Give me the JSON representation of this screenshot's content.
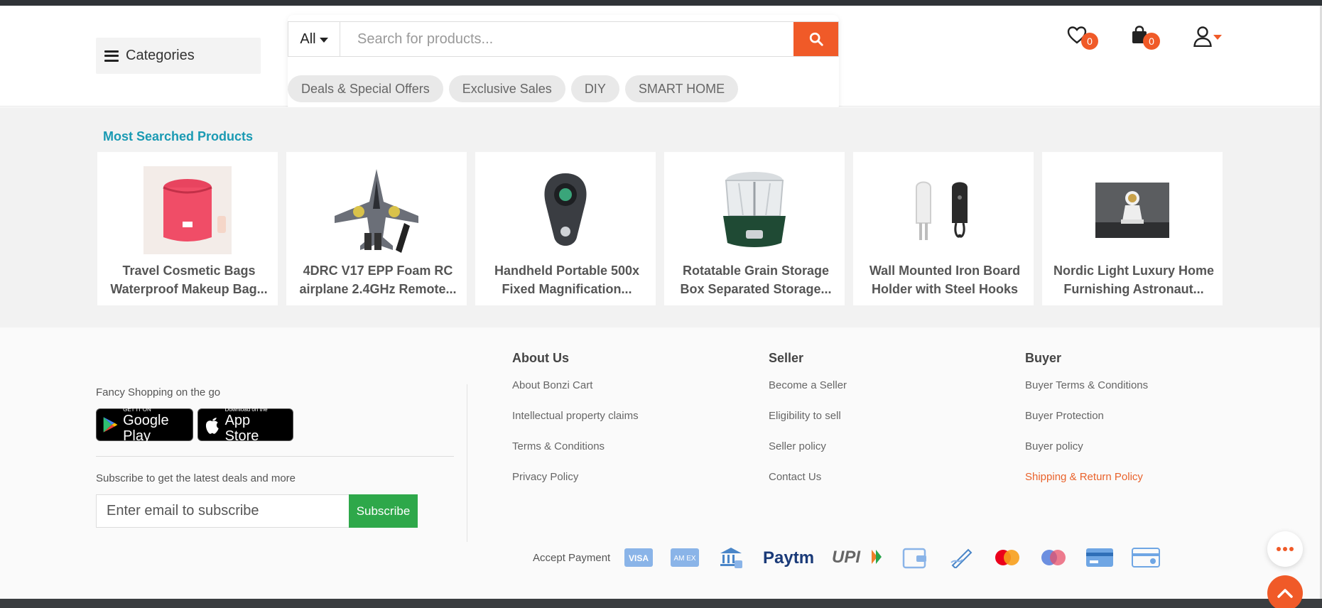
{
  "header": {
    "categories_label": "Categories",
    "search": {
      "filter_value": "All",
      "placeholder": "Search for products..."
    },
    "chips": [
      "Deals & Special Offers",
      "Exclusive Sales",
      "DIY",
      "SMART HOME"
    ],
    "wishlist_count": "0",
    "cart_count": "0"
  },
  "most_searched": {
    "title": "Most Searched Products",
    "products": [
      {
        "line1": "Travel Cosmetic Bags",
        "line2": "Waterproof Makeup Bag..."
      },
      {
        "line1": "4DRC V17 EPP Foam RC",
        "line2": "airplane 2.4GHz Remote..."
      },
      {
        "line1": "Handheld Portable 500x",
        "line2": "Fixed Magnification..."
      },
      {
        "line1": "Rotatable Grain Storage",
        "line2": "Box Separated Storage..."
      },
      {
        "line1": "Wall Mounted Iron Board",
        "line2": "Holder with Steel Hooks"
      },
      {
        "line1": "Nordic Light Luxury Home",
        "line2": "Furnishing Astronaut..."
      }
    ]
  },
  "footer": {
    "tagline": "Fancy Shopping on the go",
    "google_play": {
      "small": "GET IT ON",
      "big": "Google Play"
    },
    "app_store": {
      "small": "Download on the",
      "big": "App Store"
    },
    "subscribe_text": "Subscribe to get the latest deals and more",
    "subscribe_placeholder": "Enter email to subscribe",
    "subscribe_button": "Subscribe",
    "about": {
      "title": "About Us",
      "links": [
        "About Bonzi Cart",
        "Intellectual property claims",
        "Terms & Conditions",
        "Privacy Policy"
      ]
    },
    "seller": {
      "title": "Seller",
      "links": [
        "Become a Seller",
        "Eligibility to sell",
        "Seller policy",
        "Contact Us"
      ]
    },
    "buyer": {
      "title": "Buyer",
      "links": [
        "Buyer Terms & Conditions",
        "Buyer Protection",
        "Buyer policy",
        "Shipping & Return Policy"
      ]
    },
    "accept_payment": "Accept Payment",
    "payment_icons": [
      "visa-icon",
      "amex-icon",
      "netbanking-icon",
      "paytm-icon",
      "upi-icon",
      "wallet-icon",
      "cheque-icon",
      "mastercard-icon",
      "maestro-icon",
      "debit-card-icon",
      "credit-card-icon"
    ],
    "payment_logo_text": {
      "visa": "VISA",
      "amex": "AM EX",
      "paytm": "Paytm",
      "upi": "UPI"
    }
  },
  "colors": {
    "accent": "#f05a28",
    "title_teal": "#1a9ab3",
    "subscribe_green": "#2ea84a"
  }
}
